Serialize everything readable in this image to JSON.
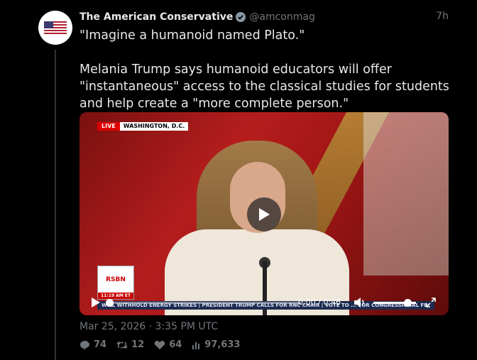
{
  "tweet": {
    "author_name": "The American Conservative",
    "handle": "@amconmag",
    "time_ago": "7h",
    "text_line1": "\"Imagine a humanoid named Plato.\"",
    "text_line2": "Melania Trump says humanoid educators will offer \"instantaneous\" access to the classical studies for students and help create a \"more complete person.\"",
    "date": "Mar 25, 2026 · 3:35 PM UTC"
  },
  "video": {
    "live_label": "LIVE",
    "location_label": "WASHINGTON, D.C.",
    "network_logo_text": "RSBN",
    "network_clock": "11:19 AM ET",
    "ticker_text": "WILL WITHHOLD ENERGY STRIKES | PRESIDENT TRUMP CALLS FOR RNC CHAIR | VOTE TO ... FOR CONGRESSIONAL FE",
    "timecode": "0:00 / 0:46",
    "progress_fraction": 0.0,
    "volume_fraction": 0.8
  },
  "stats": {
    "replies": "74",
    "retweets": "12",
    "likes": "64",
    "views": "97,633"
  },
  "colors": {
    "background": "#000000",
    "muted_text": "#71767b",
    "verified": "#8b98a5",
    "thread_line": "#2f3336"
  },
  "icons": [
    "verified-badge-icon",
    "play-icon",
    "volume-icon",
    "fullscreen-icon",
    "reply-icon",
    "retweet-icon",
    "like-icon",
    "views-icon"
  ]
}
